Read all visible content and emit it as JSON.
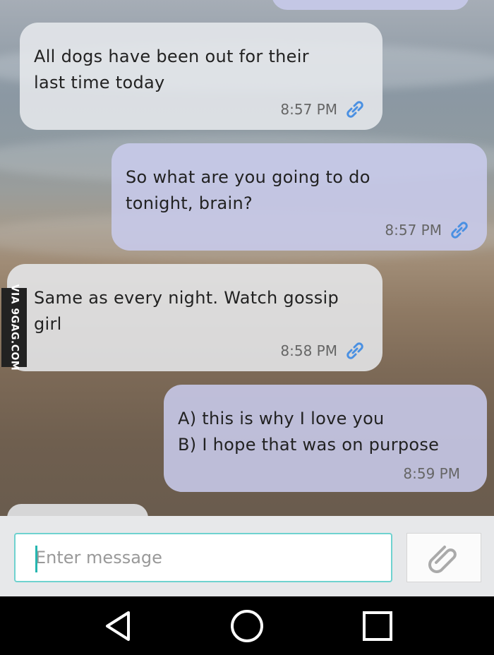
{
  "watermark": "VIA 9GAG.COM",
  "messages": [
    {
      "direction": "incoming",
      "text": "All dogs have been out for their\nlast time today",
      "time": "8:57 PM",
      "icon": "link-icon"
    },
    {
      "direction": "outgoing",
      "text": "So what are you going to do\ntonight, brain?",
      "time": "8:57 PM",
      "icon": "link-icon"
    },
    {
      "direction": "incoming",
      "text": "Same as every night. Watch gossip\ngirl",
      "time": "8:58 PM",
      "icon": "link-icon"
    },
    {
      "direction": "outgoing",
      "text": "A) this is why I love you\nB) I hope that was on purpose",
      "time": "8:59 PM",
      "icon": ""
    }
  ],
  "composer": {
    "placeholder": "Enter message",
    "attach_icon": "paperclip-icon"
  },
  "navbar": {
    "icons": [
      "back-triangle-icon",
      "home-circle-icon",
      "recents-square-icon"
    ]
  },
  "colors": {
    "incoming_bubble": "#e8eaed",
    "outgoing_bubble": "#c8cbec",
    "input_border": "#6fd2cf",
    "link_icon": "#4a90e2"
  }
}
